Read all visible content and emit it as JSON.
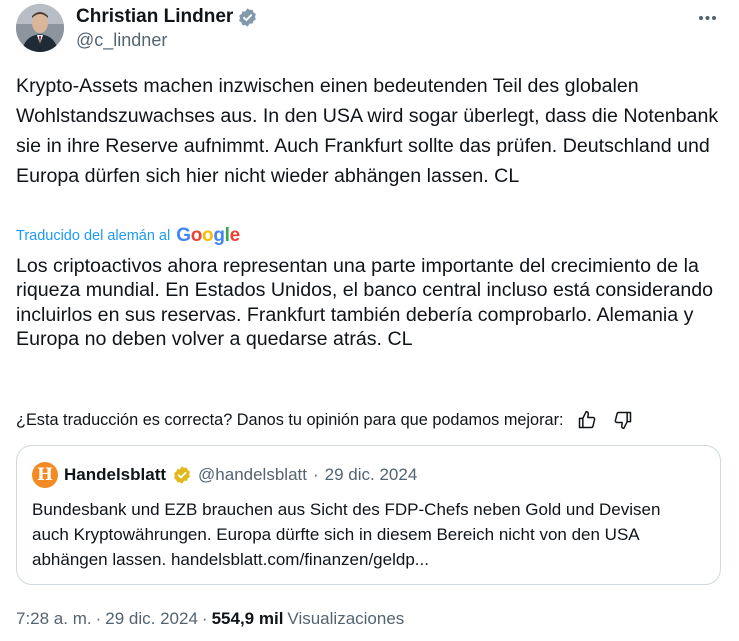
{
  "author": {
    "name": "Christian Lindner",
    "handle": "@c_lindner",
    "verified_color": "#829aab"
  },
  "tweet": {
    "text": "Krypto-Assets machen inzwischen einen bedeutenden Teil des globalen Wohlstandszuwachses aus. In den USA wird sogar überlegt, dass die Notenbank sie in ihre Reserve aufnimmt. Auch Frankfurt sollte das prüfen. Deutschland und Europa dürfen sich hier nicht wieder abhängen lassen. CL"
  },
  "translation": {
    "label": "Traducido del alemán al",
    "provider": "Google",
    "text": "Los criptoactivos ahora representan una parte importante del crecimiento de la riqueza mundial. En Estados Unidos, el banco central incluso está considerando incluirlos en sus reservas. Frankfurt también debería comprobarlo. Alemania y Europa no deben volver a quedarse atrás. CL",
    "feedback_prompt": "¿Esta traducción es correcta? Danos tu opinión para que podamos mejorar:",
    "feedback_icons": [
      "thumbs-up-icon",
      "thumbs-down-icon"
    ]
  },
  "quote": {
    "name": "Handelsblatt",
    "logo_letter": "H",
    "handle": "@handelsblatt",
    "separator": "·",
    "date": "29 dic. 2024",
    "verified_color": "#e2b719",
    "logo_color": "#f48a24",
    "text": "Bundesbank und EZB brauchen aus Sicht des FDP-Chefs neben Gold und Devisen auch Kryptowährungen. Europa dürfte sich in diesem Bereich nicht von den USA abhängen lassen. handelsblatt.com/finanzen/geldp..."
  },
  "footer": {
    "time": "7:28 a. m.",
    "date": "29 dic. 2024",
    "separator": "·",
    "views_count": "554,9 mil",
    "views_label": "Visualizaciones"
  },
  "icons": {
    "more": "more-horizontal-icon",
    "verified": "verified-badge-icon"
  }
}
